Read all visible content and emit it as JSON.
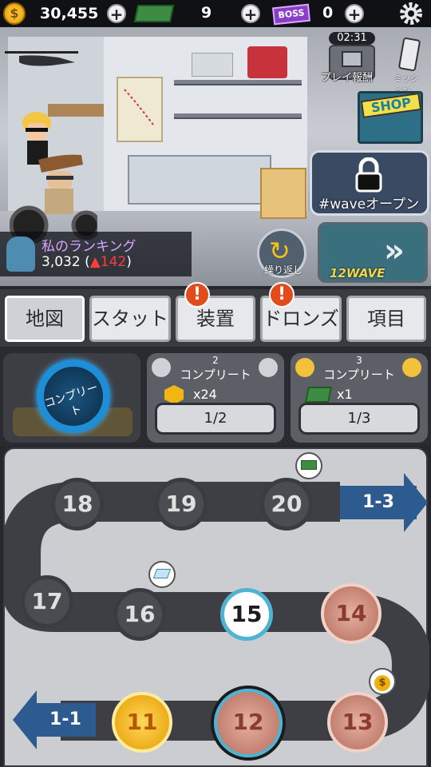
{
  "topbar": {
    "coins": "30,455",
    "cash": "9",
    "boss_tickets": "0",
    "coin_glyph": "$",
    "boss_label": "BOSS"
  },
  "scene": {
    "timer": "02:31",
    "play_reward_label": "プレイ報酬",
    "mission_label": "ミッション",
    "shop_label": "SHOP",
    "wave_open_label": "#waveオープン",
    "repeat_label": "繰り返し",
    "wave_button_label": "12WAVE",
    "ranking_title": "私のランキング",
    "ranking_value": "3,032 (",
    "ranking_change": "142",
    "ranking_close": ")"
  },
  "tabs": [
    {
      "label": "地図",
      "active": true,
      "alert": false
    },
    {
      "label": "スタット",
      "active": false,
      "alert": false
    },
    {
      "label": "装置",
      "active": false,
      "alert": true
    },
    {
      "label": "ドロンズ",
      "active": false,
      "alert": true
    },
    {
      "label": "項目",
      "active": false,
      "alert": false
    }
  ],
  "missions": {
    "complete_label": "コンプリート",
    "card1": {
      "count": "2",
      "label": "コンプリート",
      "reward": "x24",
      "progress": "1/2"
    },
    "card2": {
      "count": "3",
      "label": "コンプリート",
      "reward": "x1",
      "progress": "1/3"
    }
  },
  "map": {
    "next_area": "1-3",
    "prev_area": "1-1",
    "nodes": [
      "18",
      "19",
      "20",
      "17",
      "16",
      "15",
      "14",
      "13",
      "12",
      "11"
    ]
  },
  "colors": {
    "accent": "#4fb3d4",
    "alert": "#e44b1b",
    "area": "#2d5b8f"
  }
}
